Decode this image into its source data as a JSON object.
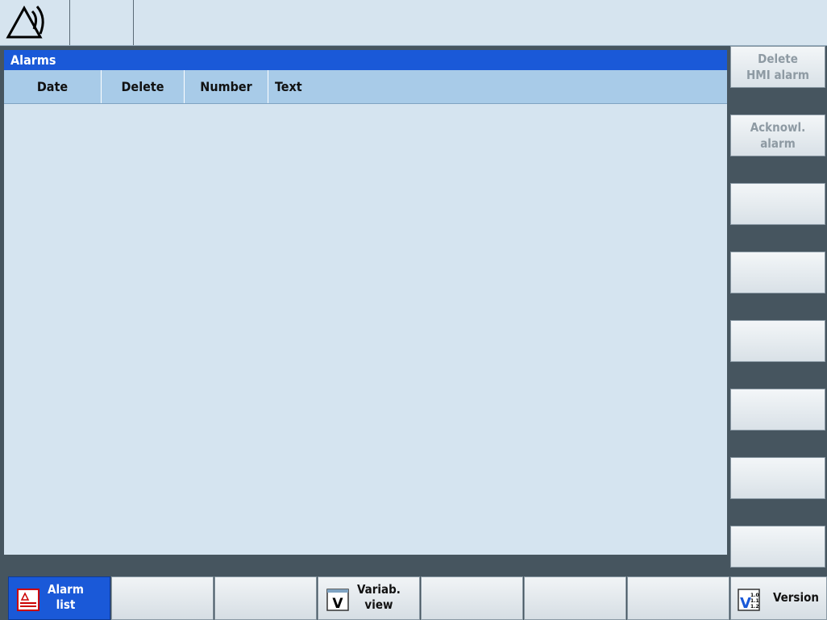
{
  "panel": {
    "title": "Alarms",
    "columns": [
      "Date",
      "Delete",
      "Number",
      "Text"
    ]
  },
  "softkeys_vertical": [
    {
      "label": "Delete\nHMI alarm",
      "enabled": false
    },
    {
      "label": "Acknowl.\nalarm",
      "enabled": false
    },
    {
      "label": "",
      "enabled": false
    },
    {
      "label": "",
      "enabled": false
    },
    {
      "label": "",
      "enabled": false
    },
    {
      "label": "",
      "enabled": false
    },
    {
      "label": "",
      "enabled": false
    },
    {
      "label": "",
      "enabled": false
    }
  ],
  "softkeys_horizontal": [
    {
      "label": "Alarm\nlist",
      "icon": "alarm-list-icon",
      "active": true
    },
    {
      "label": "",
      "icon": "",
      "active": false
    },
    {
      "label": "",
      "icon": "",
      "active": false
    },
    {
      "label": "Variab.\nview",
      "icon": "variable-view-icon",
      "active": false
    },
    {
      "label": "",
      "icon": "",
      "active": false
    },
    {
      "label": "",
      "icon": "",
      "active": false
    },
    {
      "label": "",
      "icon": "",
      "active": false
    },
    {
      "label": "Version",
      "icon": "version-icon",
      "active": false
    }
  ],
  "colors": {
    "accent": "#1a59d8",
    "panel_bg": "#d5e4f0",
    "header_bg": "#a8cbe8",
    "frame_bg": "#46555f"
  }
}
